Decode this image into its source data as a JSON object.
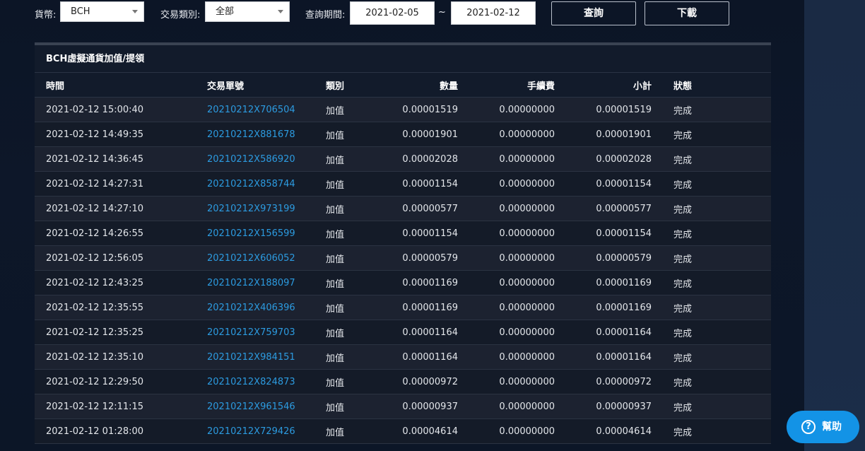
{
  "filters": {
    "currency_label": "貨幣:",
    "currency_value": "BCH",
    "type_label": "交易類別:",
    "type_value": "全部",
    "period_label": "查詢期間:",
    "date_from": "2021-02-05",
    "date_separator": "~",
    "date_to": "2021-02-12",
    "query_button": "查詢",
    "download_button": "下載"
  },
  "panel": {
    "title": "BCH虛擬通貨加值/提領"
  },
  "table": {
    "headers": {
      "time": "時間",
      "id": "交易單號",
      "type": "類別",
      "qty": "數量",
      "fee": "手續費",
      "subtotal": "小計",
      "status": "狀態"
    },
    "rows": [
      {
        "time": "2021-02-12 15:00:40",
        "id": "20210212X706504",
        "type": "加值",
        "qty": "0.00001519",
        "fee": "0.00000000",
        "subtotal": "0.00001519",
        "status": "完成"
      },
      {
        "time": "2021-02-12 14:49:35",
        "id": "20210212X881678",
        "type": "加值",
        "qty": "0.00001901",
        "fee": "0.00000000",
        "subtotal": "0.00001901",
        "status": "完成"
      },
      {
        "time": "2021-02-12 14:36:45",
        "id": "20210212X586920",
        "type": "加值",
        "qty": "0.00002028",
        "fee": "0.00000000",
        "subtotal": "0.00002028",
        "status": "完成"
      },
      {
        "time": "2021-02-12 14:27:31",
        "id": "20210212X858744",
        "type": "加值",
        "qty": "0.00001154",
        "fee": "0.00000000",
        "subtotal": "0.00001154",
        "status": "完成"
      },
      {
        "time": "2021-02-12 14:27:10",
        "id": "20210212X973199",
        "type": "加值",
        "qty": "0.00000577",
        "fee": "0.00000000",
        "subtotal": "0.00000577",
        "status": "完成"
      },
      {
        "time": "2021-02-12 14:26:55",
        "id": "20210212X156599",
        "type": "加值",
        "qty": "0.00001154",
        "fee": "0.00000000",
        "subtotal": "0.00001154",
        "status": "完成"
      },
      {
        "time": "2021-02-12 12:56:05",
        "id": "20210212X606052",
        "type": "加值",
        "qty": "0.00000579",
        "fee": "0.00000000",
        "subtotal": "0.00000579",
        "status": "完成"
      },
      {
        "time": "2021-02-12 12:43:25",
        "id": "20210212X188097",
        "type": "加值",
        "qty": "0.00001169",
        "fee": "0.00000000",
        "subtotal": "0.00001169",
        "status": "完成"
      },
      {
        "time": "2021-02-12 12:35:55",
        "id": "20210212X406396",
        "type": "加值",
        "qty": "0.00001169",
        "fee": "0.00000000",
        "subtotal": "0.00001169",
        "status": "完成"
      },
      {
        "time": "2021-02-12 12:35:25",
        "id": "20210212X759703",
        "type": "加值",
        "qty": "0.00001164",
        "fee": "0.00000000",
        "subtotal": "0.00001164",
        "status": "完成"
      },
      {
        "time": "2021-02-12 12:35:10",
        "id": "20210212X984151",
        "type": "加值",
        "qty": "0.00001164",
        "fee": "0.00000000",
        "subtotal": "0.00001164",
        "status": "完成"
      },
      {
        "time": "2021-02-12 12:29:50",
        "id": "20210212X824873",
        "type": "加值",
        "qty": "0.00000972",
        "fee": "0.00000000",
        "subtotal": "0.00000972",
        "status": "完成"
      },
      {
        "time": "2021-02-12 12:11:15",
        "id": "20210212X961546",
        "type": "加值",
        "qty": "0.00000937",
        "fee": "0.00000000",
        "subtotal": "0.00000937",
        "status": "完成"
      },
      {
        "time": "2021-02-12 01:28:00",
        "id": "20210212X729426",
        "type": "加值",
        "qty": "0.00004614",
        "fee": "0.00000000",
        "subtotal": "0.00004614",
        "status": "完成"
      }
    ]
  },
  "help": {
    "icon": "question-mark-icon",
    "label": "幫助"
  },
  "colors": {
    "link": "#2c9be0",
    "help_button": "#1393e6",
    "background": "#0c1526"
  }
}
